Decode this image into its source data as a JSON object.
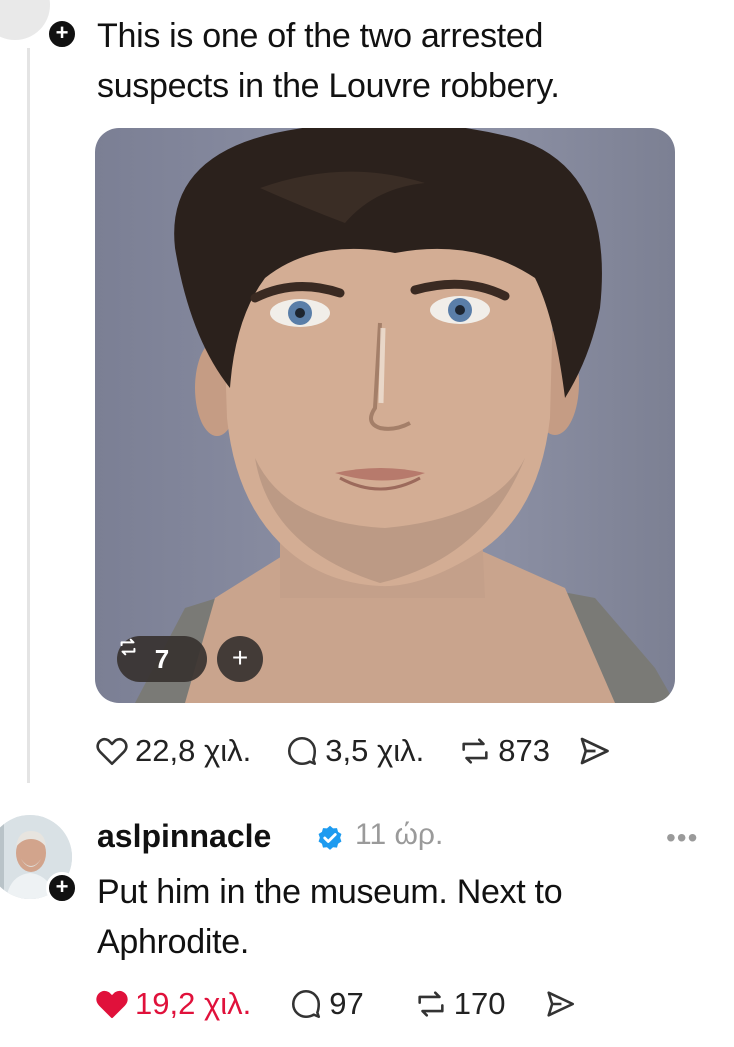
{
  "post": {
    "text_line1": "This is one of the two arrested",
    "text_line2": "suspects in the Louvre robbery.",
    "media": {
      "repost_label": "7",
      "add_label": "+"
    },
    "stats": {
      "likes": "22,8 χιλ.",
      "replies": "3,5 χιλ.",
      "reposts": "873"
    }
  },
  "reply": {
    "username": "aslpinnacle",
    "time": "11 ώρ.",
    "text_line1": "Put him in the museum. Next to",
    "text_line2": "Aphrodite.",
    "stats": {
      "likes": "19,2 χιλ.",
      "replies": "97",
      "reposts": "170"
    },
    "liked_color": "#e0113b"
  },
  "icons": [
    "heart-icon",
    "comment-icon",
    "repost-icon",
    "share-icon",
    "verified-badge-icon",
    "more-icon",
    "follow-plus-icon"
  ],
  "colors": {
    "verified": "#1d9bf0",
    "muted": "#9a9a9a",
    "text": "#111111"
  }
}
